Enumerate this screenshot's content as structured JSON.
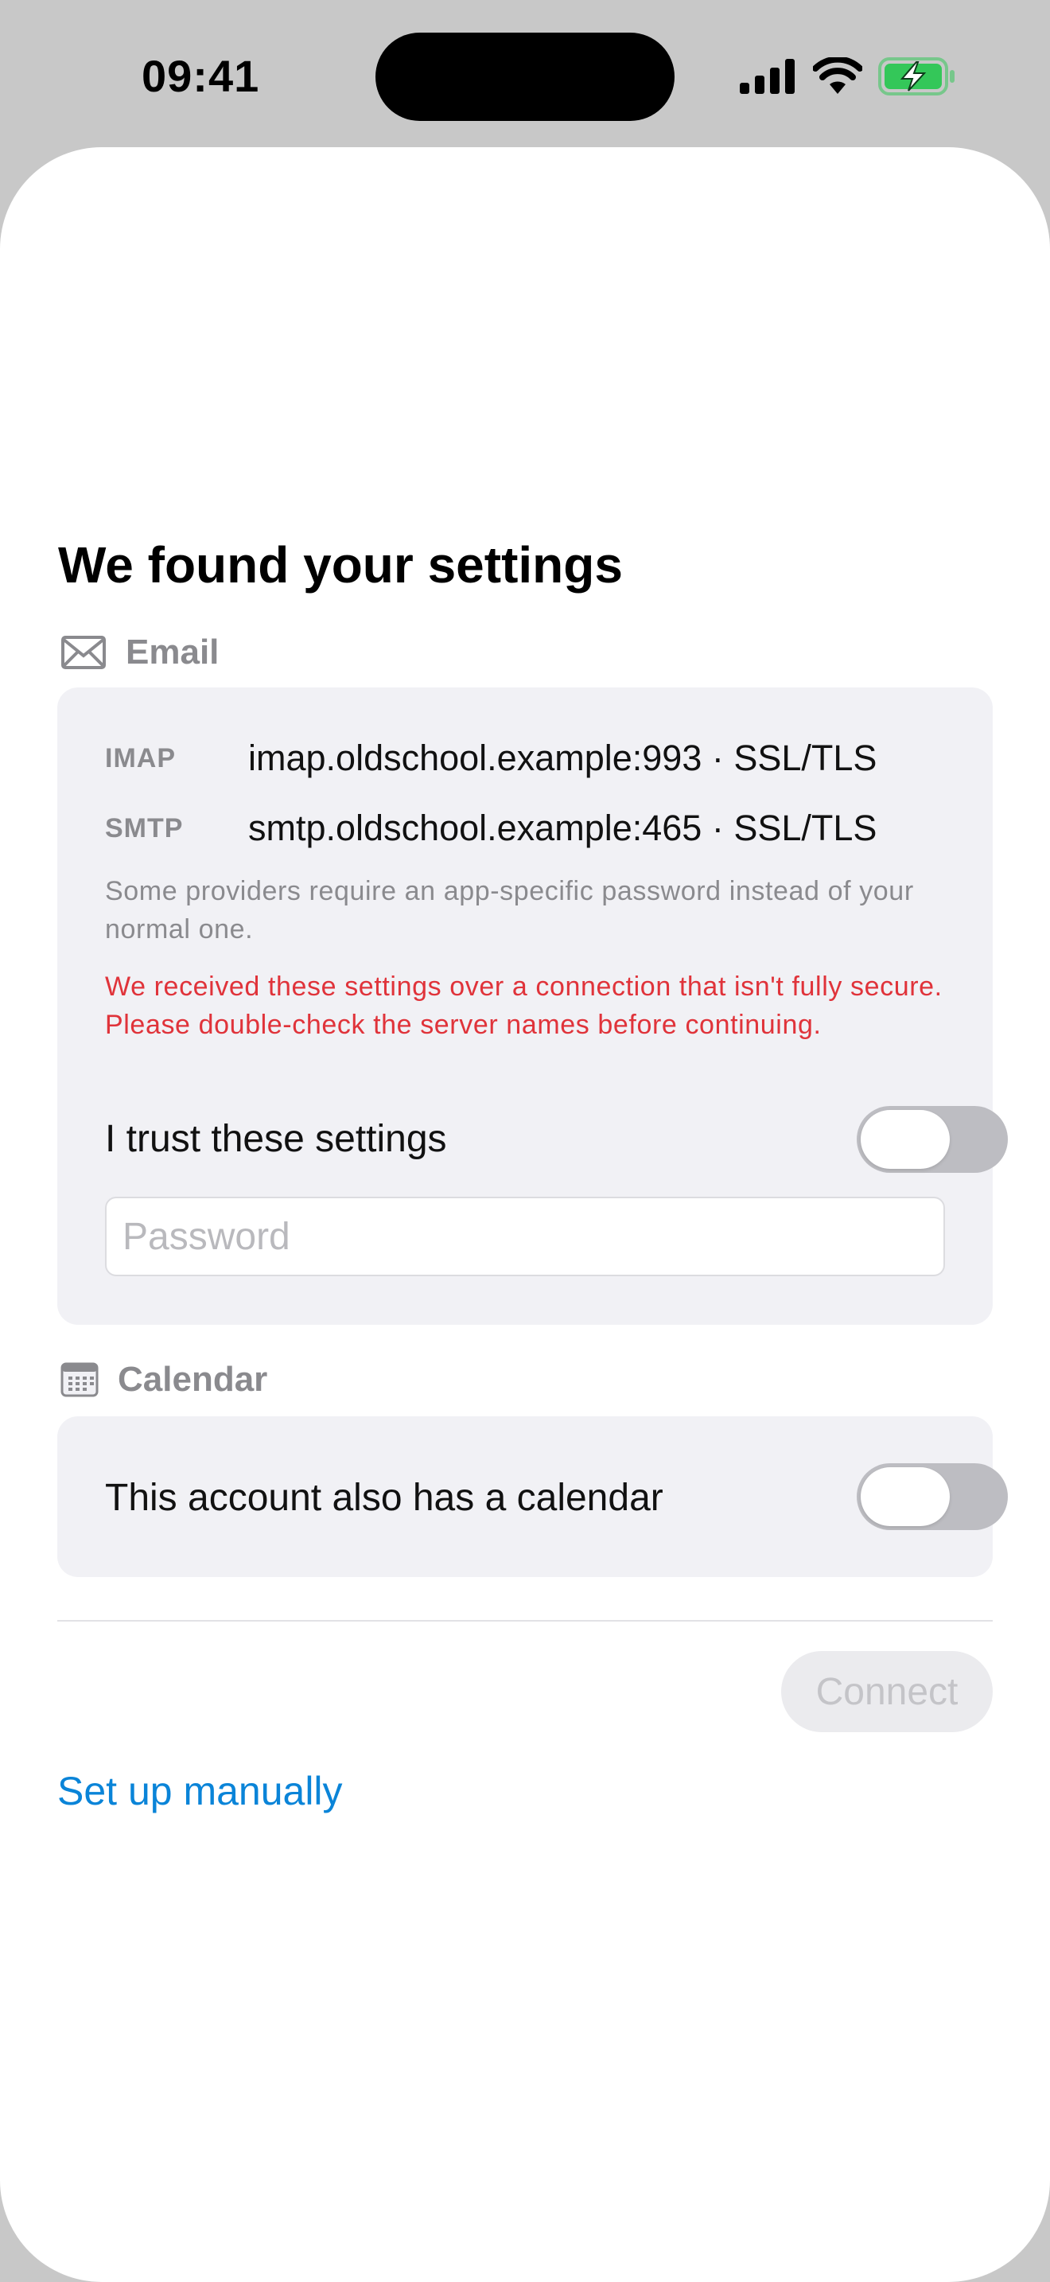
{
  "status_bar": {
    "time": "09:41",
    "icons": [
      "cellular-signal-icon",
      "wifi-icon",
      "battery-charging-icon"
    ],
    "battery_color": "#34c759"
  },
  "sheet": {
    "title": "We found your settings",
    "email_section": {
      "icon": "envelope-icon",
      "label": "Email",
      "imap": {
        "protocol": "IMAP",
        "value": "imap.oldschool.example:993 · SSL/TLS"
      },
      "smtp": {
        "protocol": "SMTP",
        "value": "smtp.oldschool.example:465 · SSL/TLS"
      },
      "hint": "Some providers require an app-specific password instead of your normal one.",
      "warning": "We received these settings over a connection that isn't fully secure. Please double-check the server names before continuing.",
      "warning_color": "#e0333a",
      "trust_label": "I trust these settings",
      "trust_enabled": false,
      "password_placeholder": "Password",
      "password_value": ""
    },
    "calendar_section": {
      "icon": "calendar-icon",
      "label": "Calendar",
      "calendar_label": "This account also has a calendar",
      "calendar_enabled": false
    },
    "connect_label": "Connect",
    "connect_enabled": false,
    "manual_link": "Set up manually",
    "accent_color": "#0a84d8"
  }
}
